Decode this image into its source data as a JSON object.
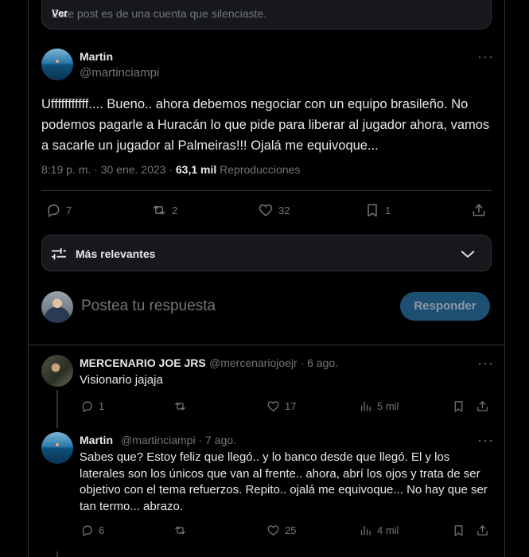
{
  "quoted_notice": {
    "text": "Este post es de una cuenta que silenciaste.",
    "action": "Ver"
  },
  "main_post": {
    "name": "Martin",
    "handle": "@martinciampi",
    "text": "Ufffffffffff.... Bueno.. ahora debemos negociar con un equipo brasileño. No podemos pagarle a Huracán lo que pide para liberar al jugador ahora, vamos a sacarle un jugador al Palmeiras!!! Ojalá me equivoque...",
    "time": "8:19 p. m. · 30 ene. 2023 · ",
    "views_count": "63,1 mil",
    "views_label": " Reproducciones",
    "replies": "7",
    "reposts": "2",
    "likes": "32",
    "bookmarks": "1"
  },
  "sort": {
    "label": "Más relevantes"
  },
  "compose": {
    "placeholder": "Postea tu respuesta",
    "button": "Responder"
  },
  "replies": [
    {
      "name": "MERCENARIO JOE JRS",
      "handle_date": "@mercenariojoejr · 6 ago.",
      "text": "Visionario jajaja",
      "replies": "1",
      "reposts": "",
      "likes": "17",
      "views": "5 mil"
    },
    {
      "name": "Martin",
      "handle_date": "@martinciampi · 7 ago.",
      "text": "Sabes que? Estoy feliz que llegó.. y lo banco desde que llegó. El y los laterales son los únicos que van al frente.. ahora, abrí los ojos y trata de ser objetivo con el tema refuerzos. Repito.. ojalá me equivoque... No hay que ser tan termo... abrazo.",
      "replies": "6",
      "reposts": "",
      "likes": "25",
      "views": "4 mil"
    }
  ],
  "colors": {
    "accent": "#1d9bf0",
    "button_disabled": "#1d4f73",
    "muted": "#71767b",
    "border": "#2f3336"
  },
  "icons": [
    "reply-icon",
    "repost-icon",
    "like-icon",
    "bookmark-icon",
    "share-icon",
    "views-icon",
    "filter-icon",
    "chevron-down-icon",
    "more-icon"
  ]
}
